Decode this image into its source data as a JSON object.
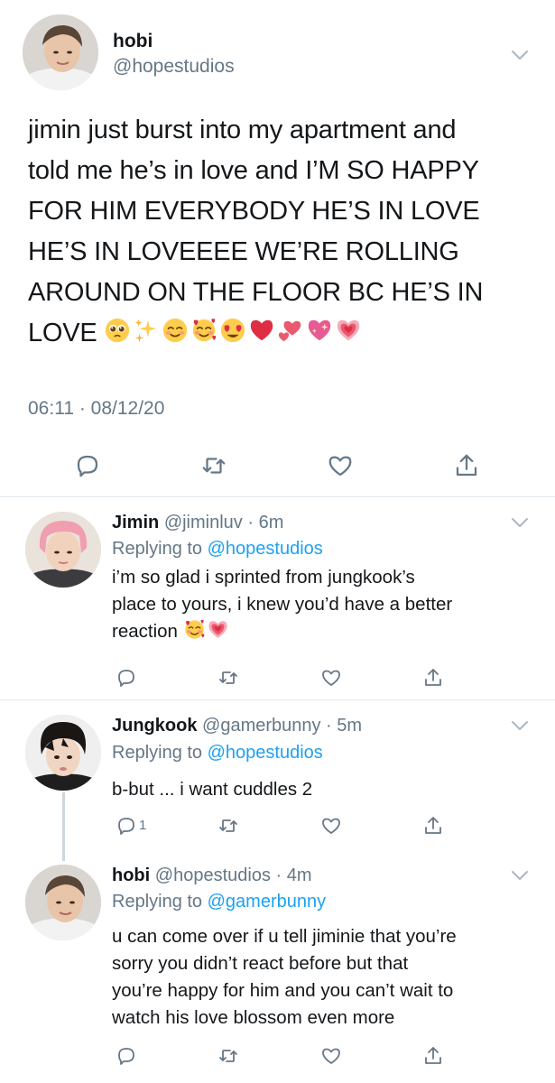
{
  "main_tweet": {
    "name": "hobi",
    "handle": "@hopestudios",
    "text_lines": [
      "jimin just burst into my apartment and",
      "told me he’s in love and I’M SO HAPPY",
      "FOR HIM EVERYBODY HE’S IN LOVE",
      "HE’S IN LOVEEEE WE’RE ROLLING",
      "AROUND ON THE FLOOR BC HE’S IN",
      "LOVE"
    ],
    "emojis": [
      "pleading-face",
      "sparkles",
      "smiling-face",
      "smiling-face-with-hearts",
      "heart-eyes",
      "red-heart",
      "two-hearts",
      "sparkling-heart",
      "growing-heart"
    ],
    "timestamp": "06:11 · 08/12/20"
  },
  "replies": [
    {
      "name": "Jimin",
      "meta": "@jiminluv · 6m",
      "replying_prefix": "Replying to",
      "replying_handle": "@hopestudios",
      "text_lines": [
        "i’m so glad i sprinted from jungkook’s",
        "place to yours, i knew you’d have a better",
        "reaction"
      ],
      "emojis": [
        "smiling-face-with-hearts",
        "growing-heart"
      ],
      "reply_count": ""
    },
    {
      "name": "Jungkook",
      "meta": "@gamerbunny · 5m",
      "replying_prefix": "Replying to",
      "replying_handle": "@hopestudios",
      "text_lines": [
        "b-but ... i want cuddles 2"
      ],
      "emojis": [],
      "reply_count": "1"
    },
    {
      "name": "hobi",
      "meta": "@hopestudios · 4m",
      "replying_prefix": "Replying to",
      "replying_handle": "@gamerbunny",
      "text_lines": [
        "u can come over if u tell jiminie that you’re",
        "sorry you didn’t react before but that",
        "you’re happy for him and you can’t wait to",
        "watch his love blossom even more"
      ],
      "emojis": [],
      "reply_count": ""
    }
  ],
  "icons": {
    "reply": "reply-icon",
    "retweet": "retweet-icon",
    "like": "like-icon",
    "share": "share-icon",
    "more": "chevron-down-icon"
  },
  "colors": {
    "text": "#14171a",
    "secondary": "#657786",
    "link": "#1da1f2",
    "divider": "#e1e8ed",
    "thread_line": "#ccd6dd"
  }
}
